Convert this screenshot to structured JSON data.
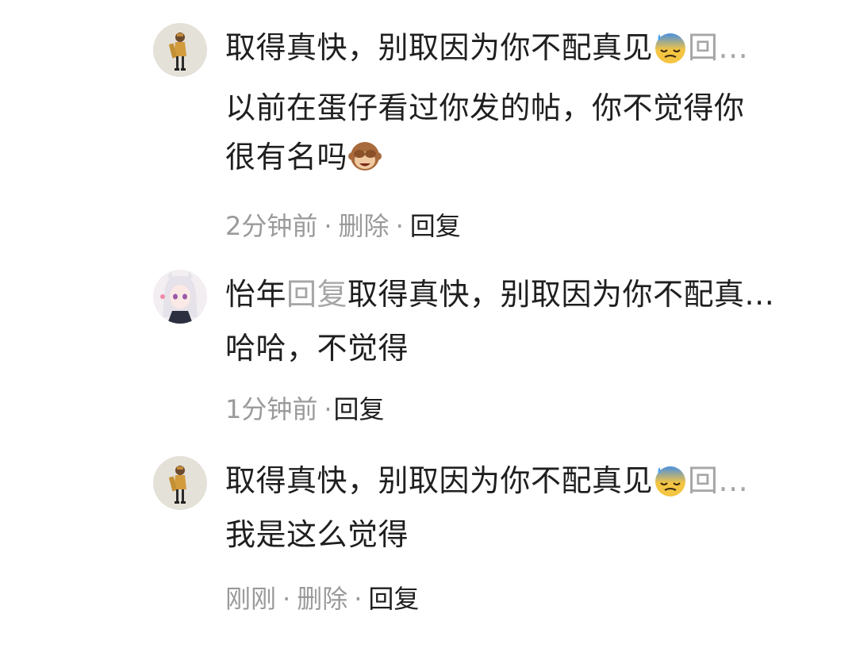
{
  "comments": [
    {
      "head_text": "取得真快，别取因为你不配真见",
      "head_emoji": "anxious-sweat-face-emoji",
      "head_tail": "回...",
      "body_lines": [
        "以前在蛋仔看过你发的帖，你不觉得你",
        "很有名吗"
      ],
      "body_emoji": "see-no-evil-monkey-emoji",
      "time": "2分钟前",
      "sep": "·",
      "delete_label": "删除",
      "reply_label": "回复",
      "avatar": "girl-avatar"
    },
    {
      "author": "怡年",
      "reply_word": "回复",
      "head_text": "取得真快，别取因为你不配真...",
      "body_lines": [
        "哈哈，不觉得"
      ],
      "time": "1分钟前",
      "sep": "·",
      "reply_label": "回复",
      "avatar": "cat-girl-avatar"
    },
    {
      "head_text": "取得真快，别取因为你不配真见",
      "head_emoji": "anxious-sweat-face-emoji",
      "head_tail": "回...",
      "body_lines": [
        "我是这么觉得"
      ],
      "time": "刚刚",
      "sep": "·",
      "delete_label": "删除",
      "reply_label": "回复",
      "avatar": "girl-avatar"
    }
  ]
}
